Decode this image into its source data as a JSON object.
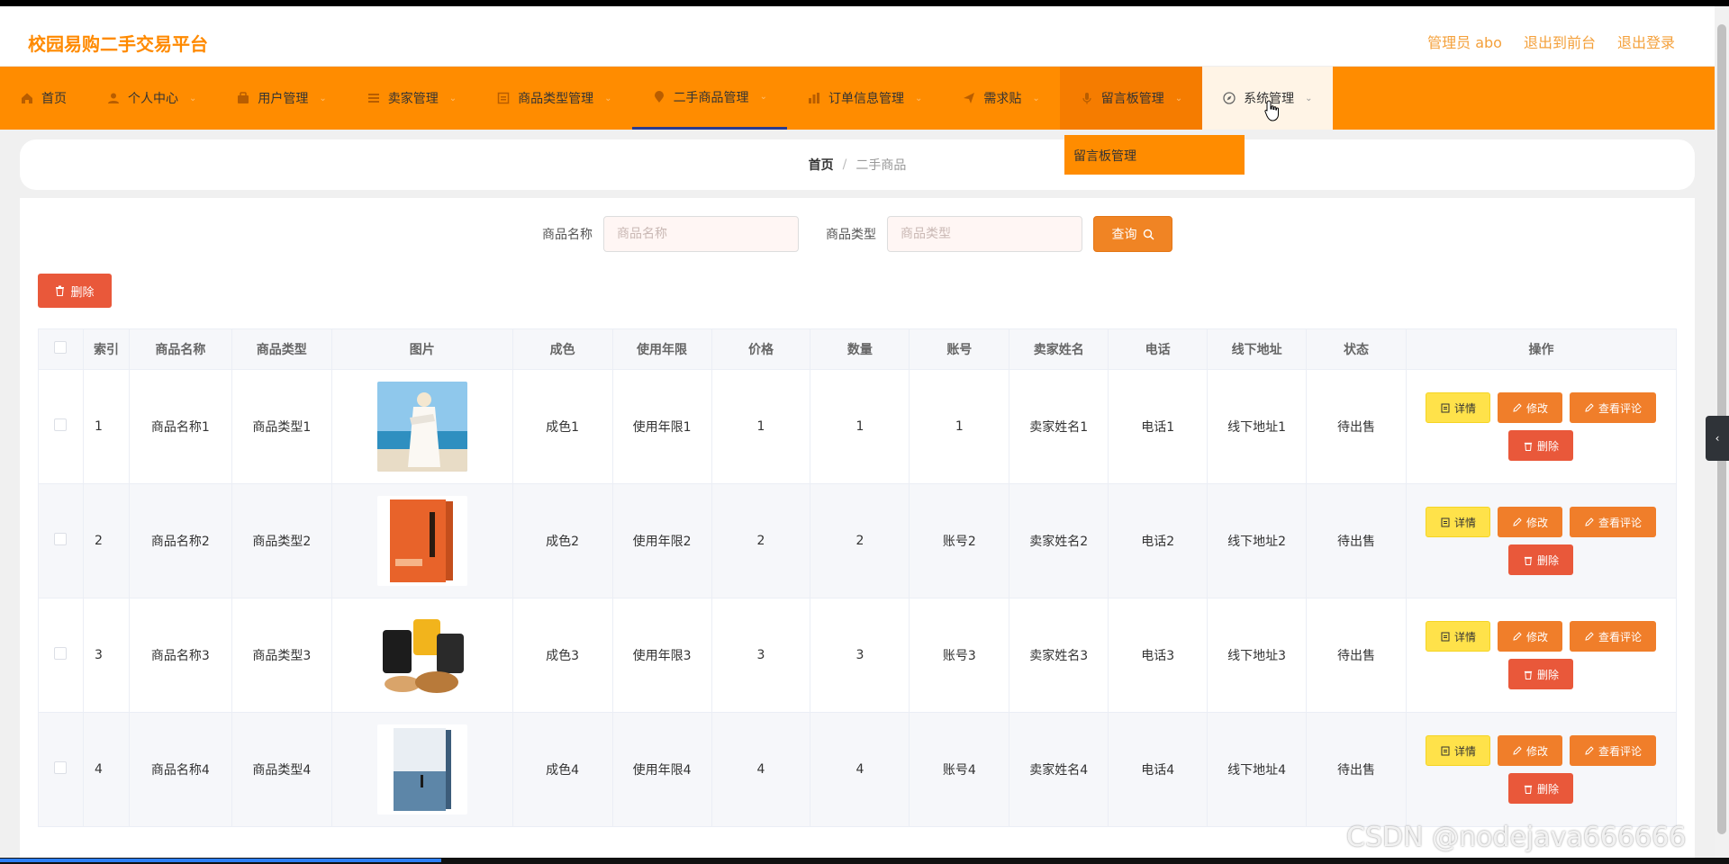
{
  "brand": "校园易购二手交易平台",
  "top_links": [
    "管理员 abo",
    "退出到前台",
    "退出登录"
  ],
  "nav": [
    {
      "label": "首页",
      "icon": "home-icon"
    },
    {
      "label": "个人中心",
      "icon": "user-icon"
    },
    {
      "label": "用户管理",
      "icon": "users-icon"
    },
    {
      "label": "卖家管理",
      "icon": "list-icon"
    },
    {
      "label": "商品类型管理",
      "icon": "doc-icon"
    },
    {
      "label": "二手商品管理",
      "icon": "pin-icon"
    },
    {
      "label": "订单信息管理",
      "icon": "chart-icon"
    },
    {
      "label": "需求贴",
      "icon": "send-icon"
    },
    {
      "label": "留言板管理",
      "icon": "mic-icon"
    },
    {
      "label": "系统管理",
      "icon": "compass-icon"
    }
  ],
  "dropdown_item": "留言板管理",
  "breadcrumb": {
    "home": "首页",
    "sep": "/",
    "current": "二手商品"
  },
  "search": {
    "name_label": "商品名称",
    "name_placeholder": "商品名称",
    "type_label": "商品类型",
    "type_placeholder": "商品类型",
    "query_button": "查询"
  },
  "delete_button": "删除",
  "table": {
    "headers": [
      "索引",
      "商品名称",
      "商品类型",
      "图片",
      "成色",
      "使用年限",
      "价格",
      "数量",
      "账号",
      "卖家姓名",
      "电话",
      "线下地址",
      "状态",
      "操作"
    ],
    "rows": [
      {
        "index": "1",
        "name": "商品名称1",
        "type": "商品类型1",
        "grade": "成色1",
        "years": "使用年限1",
        "price": "1",
        "qty": "1",
        "account": "1",
        "seller": "卖家姓名1",
        "phone": "电话1",
        "address": "线下地址1",
        "status": "待出售"
      },
      {
        "index": "2",
        "name": "商品名称2",
        "type": "商品类型2",
        "grade": "成色2",
        "years": "使用年限2",
        "price": "2",
        "qty": "2",
        "account": "账号2",
        "seller": "卖家姓名2",
        "phone": "电话2",
        "address": "线下地址2",
        "status": "待出售"
      },
      {
        "index": "3",
        "name": "商品名称3",
        "type": "商品类型3",
        "grade": "成色3",
        "years": "使用年限3",
        "price": "3",
        "qty": "3",
        "account": "账号3",
        "seller": "卖家姓名3",
        "phone": "电话3",
        "address": "线下地址3",
        "status": "待出售"
      },
      {
        "index": "4",
        "name": "商品名称4",
        "type": "商品类型4",
        "grade": "成色4",
        "years": "使用年限4",
        "price": "4",
        "qty": "4",
        "account": "账号4",
        "seller": "卖家姓名4",
        "phone": "电话4",
        "address": "线下地址4",
        "status": "待出售"
      }
    ],
    "ops": {
      "detail": "详情",
      "edit": "修改",
      "review": "查看评论",
      "delete": "删除"
    }
  },
  "watermark": "CSDN @nodejava666666",
  "colors": {
    "accent": "#ff8c00",
    "danger": "#e9583a",
    "warning": "#ffe24a",
    "edit": "#f07e2a"
  }
}
